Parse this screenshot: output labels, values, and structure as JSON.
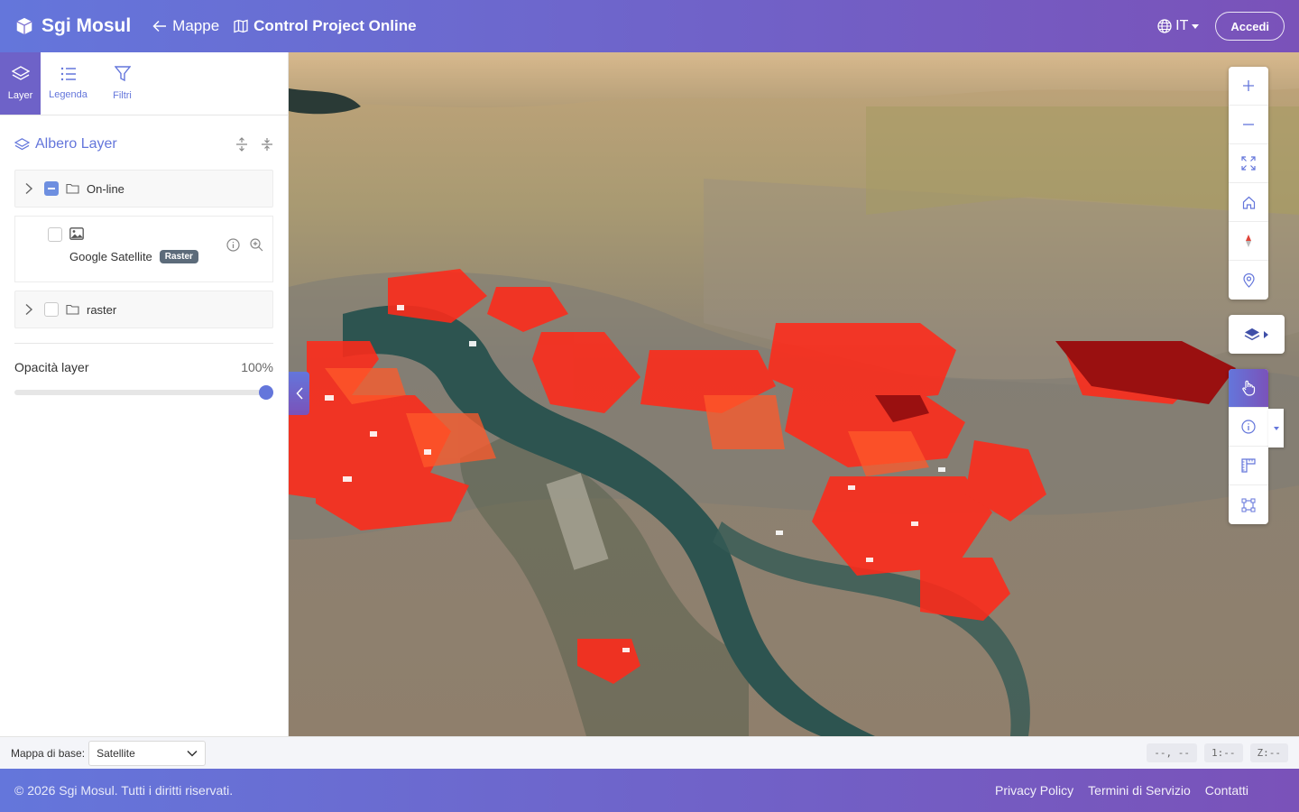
{
  "header": {
    "brand": "Sgi Mosul",
    "back_link": "Mappe",
    "project": "Control Project Online",
    "language": "IT",
    "login": "Accedi"
  },
  "sidebar": {
    "tabs": [
      {
        "label": "Layer",
        "icon": "layers-icon",
        "active": true
      },
      {
        "label": "Legenda",
        "icon": "list-icon",
        "active": false
      },
      {
        "label": "Filtri",
        "icon": "filter-icon",
        "active": false
      }
    ],
    "tree_title": "Albero Layer",
    "nodes": [
      {
        "label": "On-line",
        "state": "partial"
      },
      {
        "label": "raster",
        "state": "unchecked"
      }
    ],
    "layer": {
      "name": "Google Satellite",
      "badge": "Raster",
      "checked": false
    },
    "opacity": {
      "label": "Opacità layer",
      "value": "100%"
    }
  },
  "statusbar": {
    "basemap_label": "Mappa di base:",
    "basemap_value": "Satellite",
    "coords": "--, --",
    "scale": "1:--",
    "zoom": "Z:--"
  },
  "footer": {
    "copyright": "© 2026 Sgi Mosul. Tutti i diritti riservati.",
    "links": [
      "Privacy Policy",
      "Termini di Servizio",
      "Contatti"
    ]
  },
  "colors": {
    "accent": "#6476db",
    "accent_end": "#7a52b9",
    "damage": "#ff2a1a"
  }
}
